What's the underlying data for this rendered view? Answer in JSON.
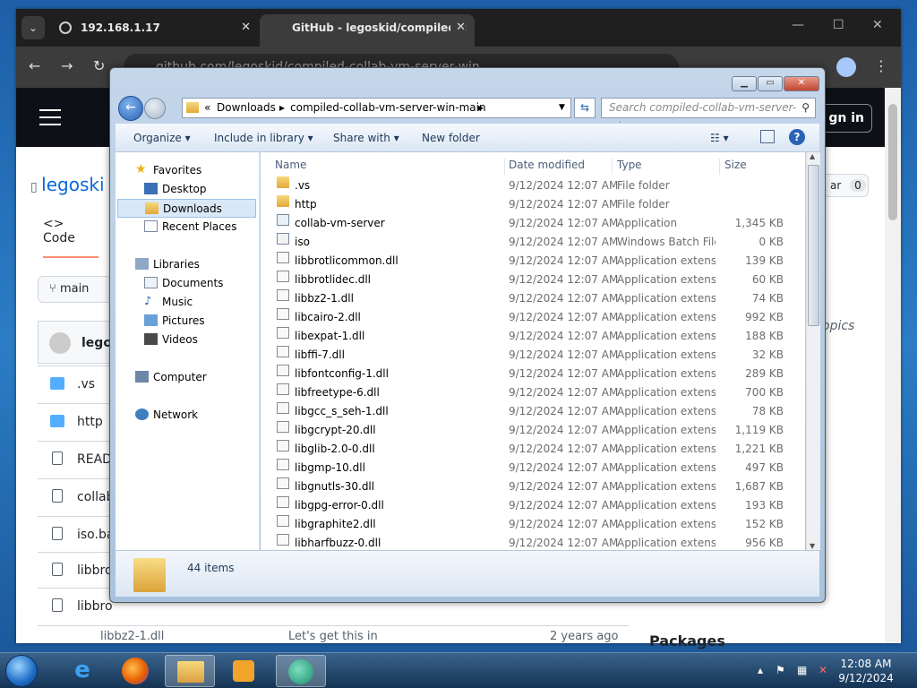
{
  "browser": {
    "tab1_title": "192.168.1.17",
    "tab2_title": "GitHub - legoskid/compiled-c",
    "tab_close": "✕",
    "tab_menu": "⌄",
    "url": "github.com/legoskid/compiled-collab-vm-server-win",
    "win_min": "—",
    "win_max": "☐",
    "win_close": "✕"
  },
  "github": {
    "repo_owner": "legoski",
    "code_tab": "Code",
    "branch": "main",
    "owner_row": "legos",
    "sign_in": "gn in",
    "star_label": "ar",
    "star_count": "0",
    "topics_text": "opics",
    "packages_label": "Packages",
    "files": [
      ".vs",
      "http",
      "READI",
      "collab",
      "iso.ba",
      "libbro",
      "libbro"
    ],
    "bottom_file": "libbz2-1.dll",
    "bottom_commit": "Let's get this in",
    "bottom_age": "2 years ago"
  },
  "explorer": {
    "breadcrumb_prefix": "«",
    "breadcrumb": [
      "Downloads",
      "compiled-collab-vm-server-win-main"
    ],
    "search_placeholder": "Search compiled-collab-vm-server-wi...",
    "commands": [
      "Organize",
      "Include in library",
      "Share with",
      "New folder"
    ],
    "nav": {
      "favorites": "Favorites",
      "fav_items": [
        "Desktop",
        "Downloads",
        "Recent Places"
      ],
      "libraries": "Libraries",
      "lib_items": [
        "Documents",
        "Music",
        "Pictures",
        "Videos"
      ],
      "computer": "Computer",
      "network": "Network"
    },
    "columns": {
      "name": "Name",
      "date": "Date modified",
      "type": "Type",
      "size": "Size"
    },
    "files": [
      {
        "name": ".vs",
        "date": "9/12/2024 12:07 AM",
        "type": "File folder",
        "size": "",
        "kind": "folder"
      },
      {
        "name": "http",
        "date": "9/12/2024 12:07 AM",
        "type": "File folder",
        "size": "",
        "kind": "folder"
      },
      {
        "name": "collab-vm-server",
        "date": "9/12/2024 12:07 AM",
        "type": "Application",
        "size": "1,345 KB",
        "kind": "app"
      },
      {
        "name": "iso",
        "date": "9/12/2024 12:07 AM",
        "type": "Windows Batch File",
        "size": "0 KB",
        "kind": "bat"
      },
      {
        "name": "libbrotlicommon.dll",
        "date": "9/12/2024 12:07 AM",
        "type": "Application extens...",
        "size": "139 KB",
        "kind": "dll"
      },
      {
        "name": "libbrotlidec.dll",
        "date": "9/12/2024 12:07 AM",
        "type": "Application extens...",
        "size": "60 KB",
        "kind": "dll"
      },
      {
        "name": "libbz2-1.dll",
        "date": "9/12/2024 12:07 AM",
        "type": "Application extens...",
        "size": "74 KB",
        "kind": "dll"
      },
      {
        "name": "libcairo-2.dll",
        "date": "9/12/2024 12:07 AM",
        "type": "Application extens...",
        "size": "992 KB",
        "kind": "dll"
      },
      {
        "name": "libexpat-1.dll",
        "date": "9/12/2024 12:07 AM",
        "type": "Application extens...",
        "size": "188 KB",
        "kind": "dll"
      },
      {
        "name": "libffi-7.dll",
        "date": "9/12/2024 12:07 AM",
        "type": "Application extens...",
        "size": "32 KB",
        "kind": "dll"
      },
      {
        "name": "libfontconfig-1.dll",
        "date": "9/12/2024 12:07 AM",
        "type": "Application extens...",
        "size": "289 KB",
        "kind": "dll"
      },
      {
        "name": "libfreetype-6.dll",
        "date": "9/12/2024 12:07 AM",
        "type": "Application extens...",
        "size": "700 KB",
        "kind": "dll"
      },
      {
        "name": "libgcc_s_seh-1.dll",
        "date": "9/12/2024 12:07 AM",
        "type": "Application extens...",
        "size": "78 KB",
        "kind": "dll"
      },
      {
        "name": "libgcrypt-20.dll",
        "date": "9/12/2024 12:07 AM",
        "type": "Application extens...",
        "size": "1,119 KB",
        "kind": "dll"
      },
      {
        "name": "libglib-2.0-0.dll",
        "date": "9/12/2024 12:07 AM",
        "type": "Application extens...",
        "size": "1,221 KB",
        "kind": "dll"
      },
      {
        "name": "libgmp-10.dll",
        "date": "9/12/2024 12:07 AM",
        "type": "Application extens...",
        "size": "497 KB",
        "kind": "dll"
      },
      {
        "name": "libgnutls-30.dll",
        "date": "9/12/2024 12:07 AM",
        "type": "Application extens...",
        "size": "1,687 KB",
        "kind": "dll"
      },
      {
        "name": "libgpg-error-0.dll",
        "date": "9/12/2024 12:07 AM",
        "type": "Application extens...",
        "size": "193 KB",
        "kind": "dll"
      },
      {
        "name": "libgraphite2.dll",
        "date": "9/12/2024 12:07 AM",
        "type": "Application extens...",
        "size": "152 KB",
        "kind": "dll"
      },
      {
        "name": "libharfbuzz-0.dll",
        "date": "9/12/2024 12:07 AM",
        "type": "Application extens...",
        "size": "956 KB",
        "kind": "dll"
      }
    ],
    "item_count": "44 items"
  },
  "taskbar": {
    "time": "12:08 AM",
    "date": "9/12/2024"
  }
}
